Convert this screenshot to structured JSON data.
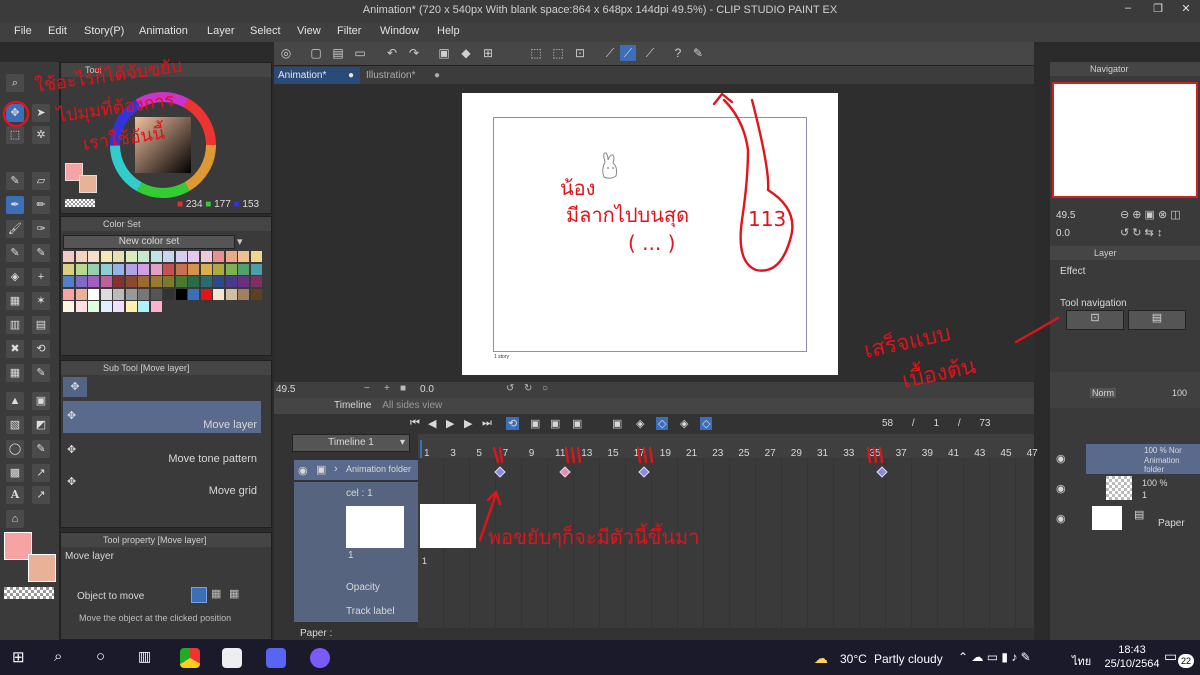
{
  "window": {
    "title": "Animation* (720 x 540px With blank space:864 x 648px 144dpi 49.5%) - CLIP STUDIO PAINT EX",
    "minimize": "–",
    "maximize": "❐",
    "close": "✕"
  },
  "menu": [
    "File",
    "Edit",
    "Story(P)",
    "Animation",
    "Layer",
    "Select",
    "View",
    "Filter",
    "Window",
    "Help"
  ],
  "doc_tabs": [
    {
      "label": "Animation*"
    },
    {
      "label": "Illustration*"
    }
  ],
  "left_panels": {
    "tool_header": "Tool",
    "color_values": {
      "r": "234",
      "g": "177",
      "b": "153"
    },
    "color_set_tab": "Color Set",
    "color_set_name": "New color set",
    "subtool_header": "Sub Tool [Move layer]",
    "subtools": [
      "Move layer",
      "Move tone pattern",
      "Move grid"
    ],
    "toolprop_header": "Tool property [Move layer]",
    "toolprop_title": "Move layer",
    "object_to_move": "Object to move",
    "move_clicked": "Move the object at the clicked position"
  },
  "canvas": {
    "story_label": "1 story",
    "zoom": "49.5",
    "angle": "0.0"
  },
  "timeline": {
    "tab": "Timeline",
    "tab2": "All sides view",
    "name": "Timeline 1",
    "frame_current": "58",
    "frame_sep": "/",
    "frame_page": "1",
    "frame_total": "73",
    "ticks": [
      "1",
      "3",
      "5",
      "7",
      "9",
      "11",
      "13",
      "15",
      "17",
      "19",
      "21",
      "23",
      "25",
      "27",
      "29",
      "31",
      "33",
      "35",
      "37",
      "39",
      "41",
      "43",
      "45",
      "47"
    ],
    "folder_label": "Animation folder",
    "cel_label": "cel : 1",
    "cel_num": "1",
    "opacity_label": "Opacity",
    "track_label": "Track label",
    "paper_label": "Paper :"
  },
  "right_panels": {
    "navigator_tab": "Navigator",
    "nav_zoom": "49.5",
    "nav_angle": "0.0",
    "layer_tab": "Layer",
    "effect_label": "Effect",
    "tool_nav_label": "Tool navigation",
    "blend_mode": "Norm",
    "opacity_val": "100",
    "layers": [
      {
        "pct": "100 % Nor",
        "name": "Animation folder"
      },
      {
        "pct": "100 %",
        "name": "1"
      },
      {
        "pct": "",
        "name": "Paper"
      }
    ]
  },
  "annotations": {
    "top_left": [
      "ใช้อะไรก็ได้จับขยับ",
      "ไปมุมที่ต้องการ",
      "เราใช้อันนี้"
    ],
    "canvas_text": [
      "น้อง",
      "มีลากไปบนสุด",
      "( ... )"
    ],
    "canvas_num": "113",
    "right_text": [
      "เสร็จแบบ",
      "เบื้องต้น"
    ],
    "timeline_text": "พอขยับๆก็จะมีตัวนี้ขึ้นมา"
  },
  "taskbar": {
    "weather_temp": "30°C",
    "weather_desc": "Partly cloudy",
    "lang": "ไทย",
    "time": "18:43",
    "date": "25/10/2564",
    "notif_count": "22"
  },
  "colors": {
    "accent": "#3d6fb8",
    "annotation": "#e0141a",
    "main_color": "#f5a3a3",
    "sub_color": "#eab199"
  }
}
